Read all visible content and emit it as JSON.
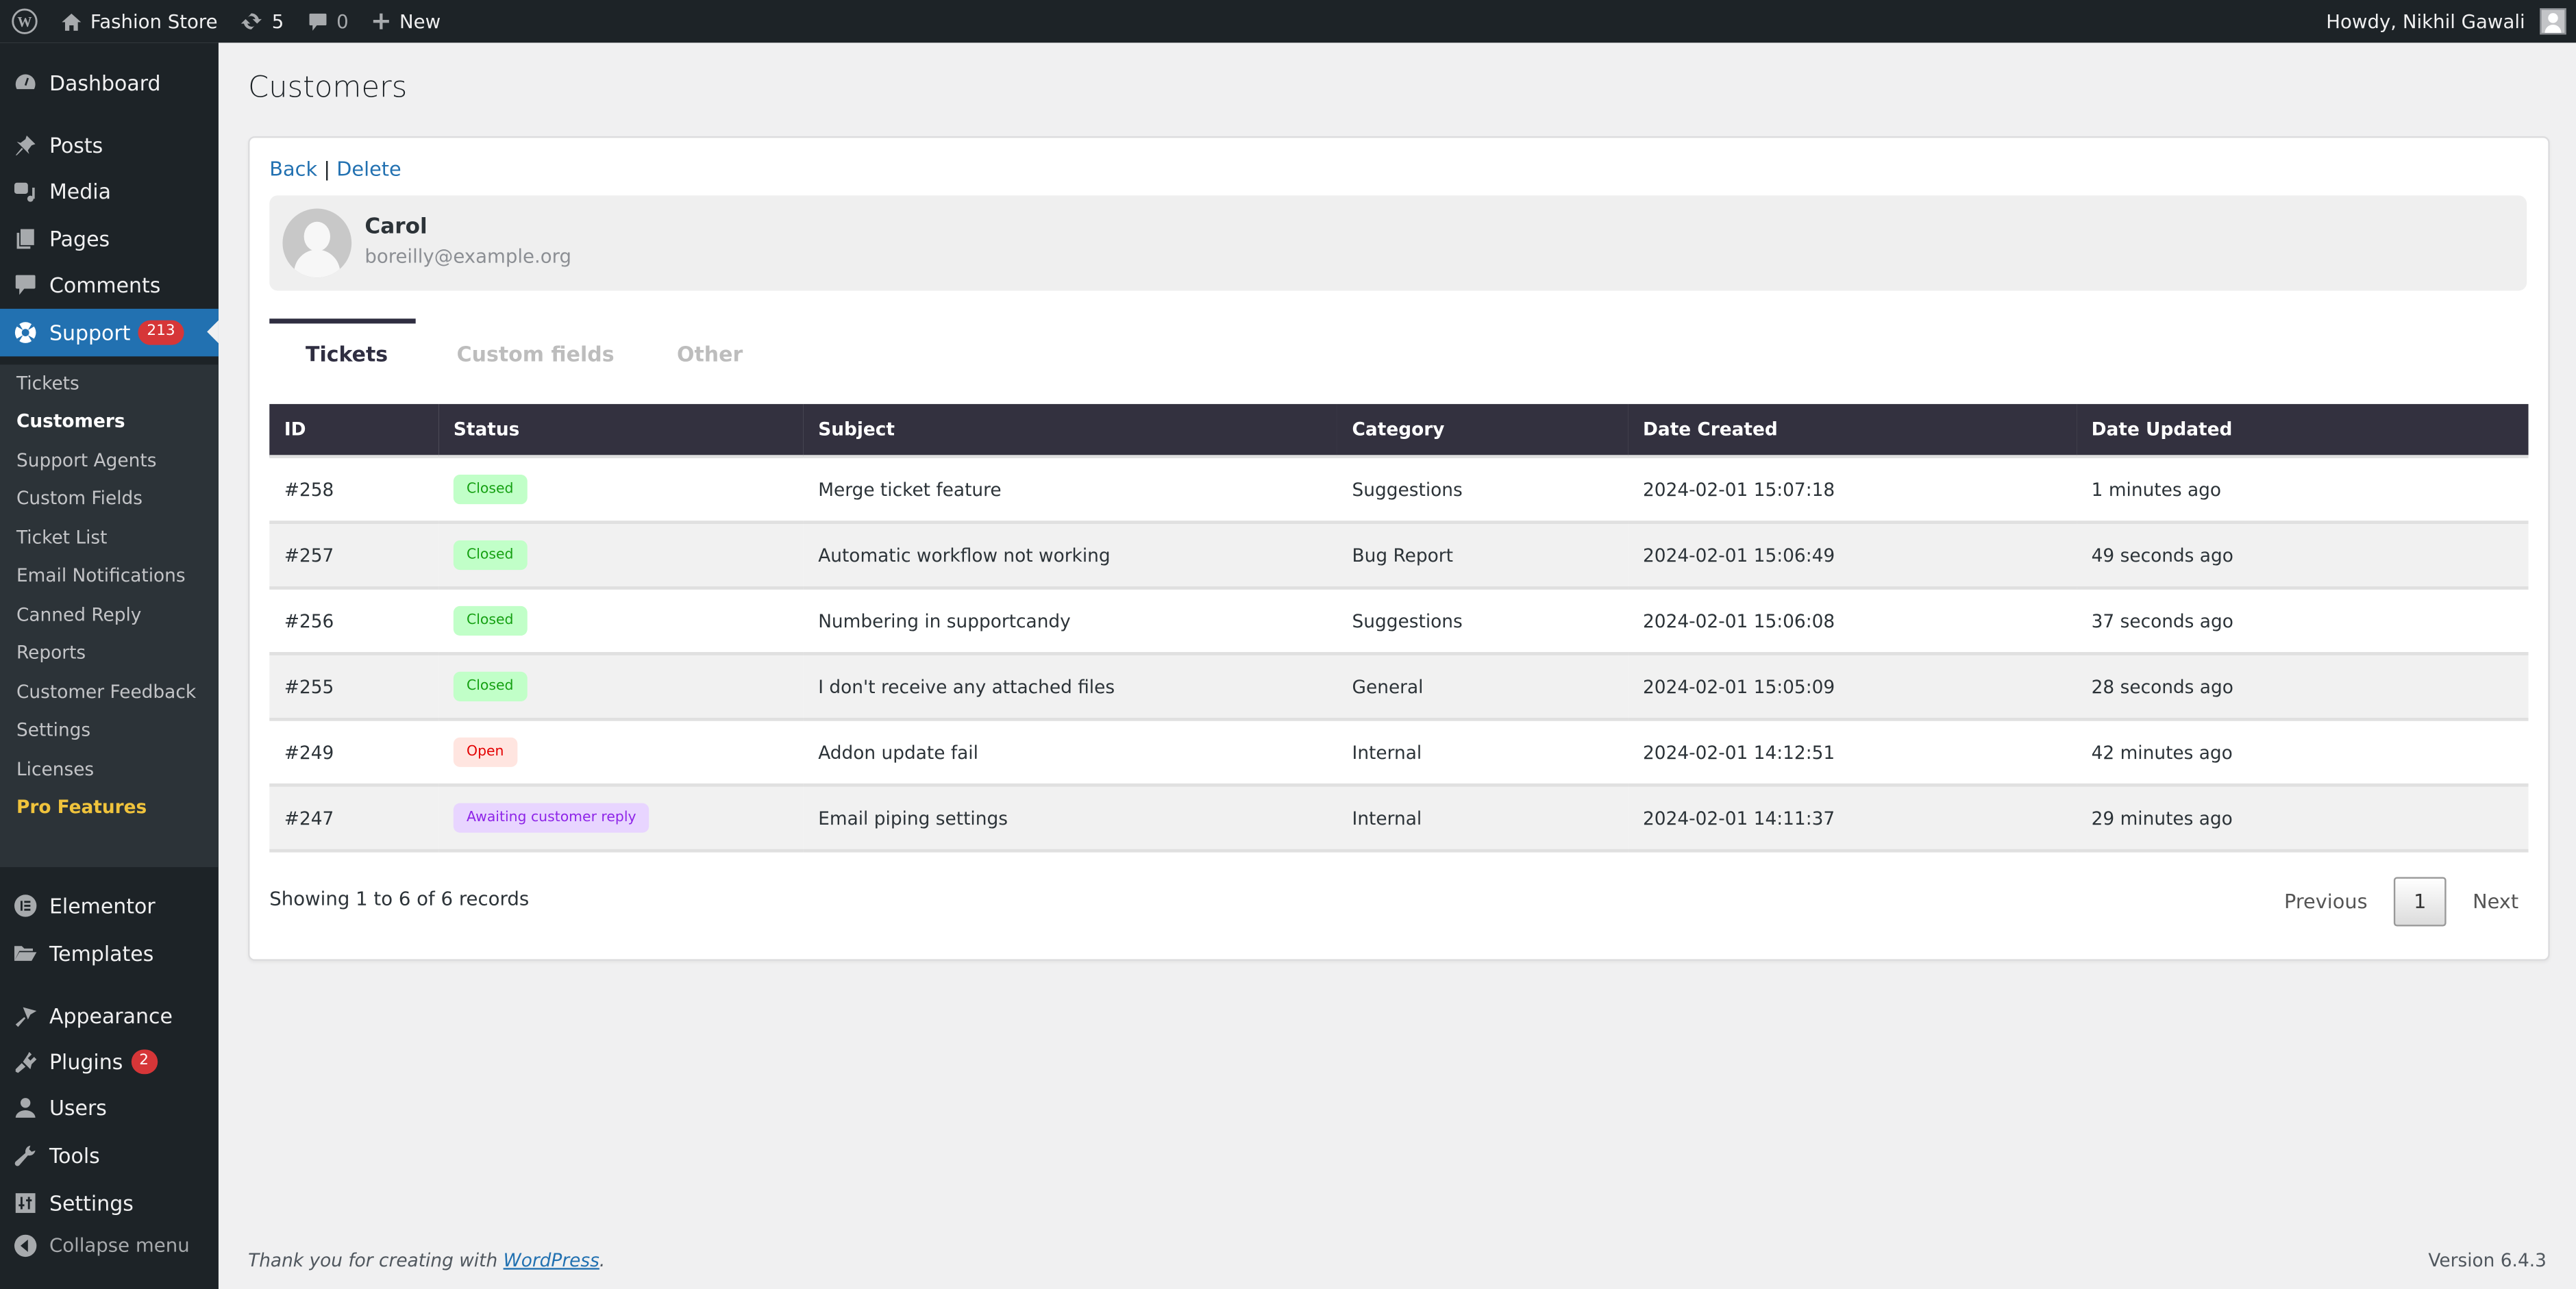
{
  "adminbar": {
    "site_name": "Fashion Store",
    "updates_count": "5",
    "comments_count": "0",
    "new_label": "New",
    "greeting": "Howdy, Nikhil Gawali"
  },
  "sidebar": {
    "items": [
      {
        "label": "Dashboard",
        "icon": "dashboard-icon"
      },
      {
        "label": "Posts",
        "icon": "pin-icon"
      },
      {
        "label": "Media",
        "icon": "media-icon"
      },
      {
        "label": "Pages",
        "icon": "pages-icon"
      },
      {
        "label": "Comments",
        "icon": "comment-icon"
      },
      {
        "label": "Support",
        "icon": "lifebuoy-icon",
        "badge": "213",
        "active": true
      },
      {
        "label": "Elementor",
        "icon": "elementor-icon"
      },
      {
        "label": "Templates",
        "icon": "folder-icon"
      },
      {
        "label": "Appearance",
        "icon": "brush-icon"
      },
      {
        "label": "Plugins",
        "icon": "plugin-icon",
        "badge": "2"
      },
      {
        "label": "Users",
        "icon": "user-icon"
      },
      {
        "label": "Tools",
        "icon": "wrench-icon"
      },
      {
        "label": "Settings",
        "icon": "settings-icon"
      }
    ],
    "submenu": [
      {
        "label": "Tickets"
      },
      {
        "label": "Customers",
        "current": true
      },
      {
        "label": "Support Agents"
      },
      {
        "label": "Custom Fields"
      },
      {
        "label": "Ticket List"
      },
      {
        "label": "Email Notifications"
      },
      {
        "label": "Canned Reply"
      },
      {
        "label": "Reports"
      },
      {
        "label": "Customer Feedback"
      },
      {
        "label": "Settings"
      },
      {
        "label": "Licenses"
      },
      {
        "label": "Pro Features",
        "pro": true
      }
    ],
    "collapse_label": "Collapse menu"
  },
  "page": {
    "title": "Customers",
    "back_label": "Back",
    "separator": "|",
    "delete_label": "Delete",
    "customer": {
      "name": "Carol",
      "email": "boreilly@example.org"
    },
    "tabs": [
      {
        "label": "Tickets",
        "active": true
      },
      {
        "label": "Custom fields"
      },
      {
        "label": "Other"
      }
    ]
  },
  "table": {
    "columns": [
      "ID",
      "Status",
      "Subject",
      "Category",
      "Date Created",
      "Date Updated"
    ],
    "rows": [
      {
        "id": "#258",
        "status": "Closed",
        "status_type": "closed",
        "subject": "Merge ticket feature",
        "category": "Suggestions",
        "created": "2024-02-01 15:07:18",
        "updated": "1 minutes ago"
      },
      {
        "id": "#257",
        "status": "Closed",
        "status_type": "closed",
        "subject": "Automatic workflow not working",
        "category": "Bug Report",
        "created": "2024-02-01 15:06:49",
        "updated": "49 seconds ago"
      },
      {
        "id": "#256",
        "status": "Closed",
        "status_type": "closed",
        "subject": "Numbering in supportcandy",
        "category": "Suggestions",
        "created": "2024-02-01 15:06:08",
        "updated": "37 seconds ago"
      },
      {
        "id": "#255",
        "status": "Closed",
        "status_type": "closed",
        "subject": "I don't receive any attached files",
        "category": "General",
        "created": "2024-02-01 15:05:09",
        "updated": "28 seconds ago"
      },
      {
        "id": "#249",
        "status": "Open",
        "status_type": "open",
        "subject": "Addon update fail",
        "category": "Internal",
        "created": "2024-02-01 14:12:51",
        "updated": "42 minutes ago"
      },
      {
        "id": "#247",
        "status": "Awaiting customer reply",
        "status_type": "awaiting",
        "subject": "Email piping settings",
        "category": "Internal",
        "created": "2024-02-01 14:11:37",
        "updated": "29 minutes ago"
      }
    ],
    "status_colors": {
      "closed": {
        "bg": "#c1ffc8",
        "fg": "#15a012"
      },
      "open": {
        "bg": "#ffe5e0",
        "fg": "#e30000"
      },
      "awaiting": {
        "bg": "#e8d5ff",
        "fg": "#8e24e8"
      }
    },
    "info": "Showing 1 to 6 of 6 records",
    "pagination": {
      "previous": "Previous",
      "current_page": "1",
      "next": "Next"
    }
  },
  "footer": {
    "thanks_prefix": "Thank you for creating with ",
    "thanks_link": "WordPress",
    "thanks_suffix": ".",
    "version": "Version 6.4.3"
  },
  "colors": {
    "accent": "#2271b1",
    "admin_dark": "#1d2327",
    "table_header": "#33313f",
    "badge_red": "#d63638",
    "pro_yellow": "#f0c33c"
  }
}
